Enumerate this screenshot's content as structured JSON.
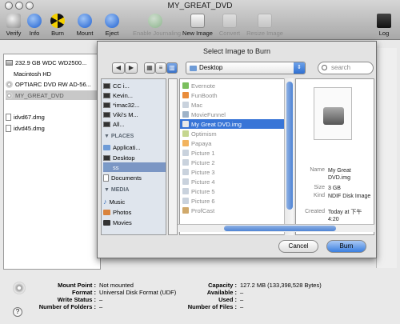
{
  "window": {
    "title": "MY_GREAT_DVD"
  },
  "toolbar": {
    "items": [
      {
        "label": "Verify",
        "icon": "verify-icon",
        "enabled": true
      },
      {
        "label": "Info",
        "icon": "info-icon",
        "enabled": true
      },
      {
        "label": "Burn",
        "icon": "burn-icon",
        "enabled": true
      },
      {
        "label": "Mount",
        "icon": "mount-icon",
        "enabled": true
      },
      {
        "label": "Eject",
        "icon": "eject-icon",
        "enabled": true
      },
      {
        "label": "Enable Journaling",
        "icon": "journaling-icon",
        "enabled": false
      },
      {
        "label": "New Image",
        "icon": "new-image-icon",
        "enabled": true
      },
      {
        "label": "Convert",
        "icon": "convert-icon",
        "enabled": false
      },
      {
        "label": "Resize Image",
        "icon": "resize-image-icon",
        "enabled": false
      },
      {
        "label": "Log",
        "icon": "log-icon",
        "enabled": true
      }
    ]
  },
  "source_list": {
    "items": [
      {
        "label": "232.9 GB WDC WD2500...",
        "kind": "disk"
      },
      {
        "label": "Macintosh HD",
        "kind": "volume"
      },
      {
        "label": "OPTIARC DVD RW AD-56...",
        "kind": "disk"
      },
      {
        "label": "MY_GREAT_DVD",
        "kind": "disc",
        "selected": true
      },
      {
        "label": "idvd67.dmg",
        "kind": "image"
      },
      {
        "label": "idvd45.dmg",
        "kind": "image"
      }
    ]
  },
  "info": {
    "mount_point_label": "Mount Point :",
    "mount_point_value": "Not mounted",
    "format_label": "Format :",
    "format_value": "Universal Disk Format (UDF)",
    "write_status_label": "Write Status :",
    "write_status_value": "–",
    "folders_label": "Number of Folders :",
    "folders_value": "–",
    "capacity_label": "Capacity :",
    "capacity_value": "127.2 MB (133,398,528 Bytes)",
    "available_label": "Available :",
    "available_value": "–",
    "used_label": "Used :",
    "used_value": "–",
    "files_label": "Number of Files :",
    "files_value": "–",
    "help_label": "?"
  },
  "sheet": {
    "title": "Select Image to Burn",
    "location": "Desktop",
    "search_placeholder": "search",
    "nav_back": "◀",
    "nav_forward": "▶",
    "sidebar": {
      "devices": [
        {
          "label": "CC i..."
        },
        {
          "label": "Kevin..."
        },
        {
          "label": "*imac32..."
        },
        {
          "label": "Viki's M..."
        },
        {
          "label": "All..."
        }
      ],
      "places_header": "PLACES",
      "places": [
        {
          "label": "Applicati...",
          "selected": false
        },
        {
          "label": "Desktop",
          "selected": true
        },
        {
          "label": "ss",
          "selected": false
        },
        {
          "label": "Documents",
          "selected": false
        }
      ],
      "media_header": "MEDIA",
      "media": [
        {
          "label": "Music"
        },
        {
          "label": "Photos"
        },
        {
          "label": "Movies"
        }
      ]
    },
    "files": [
      {
        "label": "Evernote",
        "selected": false
      },
      {
        "label": "FunBooth",
        "selected": false
      },
      {
        "label": "Mac",
        "selected": false
      },
      {
        "label": "MovieFunnel",
        "selected": false
      },
      {
        "label": "My Great DVD.img",
        "selected": true
      },
      {
        "label": "Optimism",
        "selected": false
      },
      {
        "label": "Papaya",
        "selected": false
      },
      {
        "label": "Picture 1",
        "selected": false
      },
      {
        "label": "Picture 2",
        "selected": false
      },
      {
        "label": "Picture 3",
        "selected": false
      },
      {
        "label": "Picture 4",
        "selected": false
      },
      {
        "label": "Picture 5",
        "selected": false
      },
      {
        "label": "Picture 6",
        "selected": false
      },
      {
        "label": "ProfCast",
        "selected": false
      }
    ],
    "preview": {
      "name_label": "Name",
      "name_value": "My Great DVD.img",
      "size_label": "Size",
      "size_value": "3 GB",
      "kind_label": "Kind",
      "kind_value": "NDIF Disk Image",
      "created_label": "Created",
      "created_value": "Today at 下午 4:20"
    },
    "cancel_label": "Cancel",
    "burn_label": "Burn",
    "accent_color": "#3875d7"
  }
}
